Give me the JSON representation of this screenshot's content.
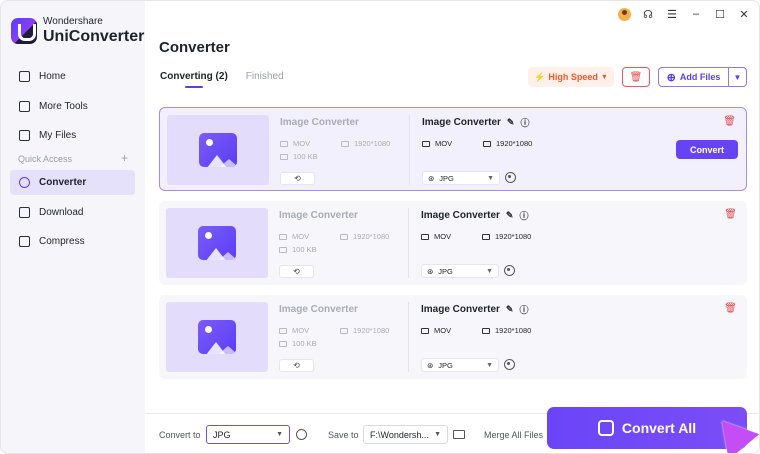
{
  "app": {
    "brand_small": "Wondershare",
    "brand_big": "UniConverter"
  },
  "sidebar": {
    "items": [
      {
        "label": "Home",
        "icon": "home-icon"
      },
      {
        "label": "More Tools",
        "icon": "toolbox-icon"
      },
      {
        "label": "My Files",
        "icon": "file-icon"
      }
    ],
    "quick_access_label": "Quick Access",
    "quick_items": [
      {
        "label": "Converter",
        "icon": "converter-icon",
        "active": true
      },
      {
        "label": "Download",
        "icon": "download-icon"
      },
      {
        "label": "Compress",
        "icon": "compress-icon"
      }
    ]
  },
  "header": {
    "title": "Converter",
    "tabs": [
      {
        "label": "Converting (2)",
        "active": true
      },
      {
        "label": "Finished"
      }
    ],
    "high_speed": "High Speed",
    "add_files": "Add Files"
  },
  "cards": [
    {
      "src_name": "Image Converter",
      "src_format": "MOV",
      "src_res": "1920*1080",
      "src_size": "100 KB",
      "dst_name": "Image Converter",
      "dst_format": "MOV",
      "dst_res": "1920*1080",
      "output_format": "JPG",
      "convert_label": "Convert",
      "selected": true
    },
    {
      "src_name": "Image Converter",
      "src_format": "MOV",
      "src_res": "1920*1080",
      "src_size": "100 KB",
      "dst_name": "Image Converter",
      "dst_format": "MOV",
      "dst_res": "1920*1080",
      "output_format": "JPG"
    },
    {
      "src_name": "Image Converter",
      "src_format": "MOV",
      "src_res": "1920*1080",
      "src_size": "100 KB",
      "dst_name": "Image Converter",
      "dst_format": "MOV",
      "dst_res": "1920*1080",
      "output_format": "JPG"
    }
  ],
  "bottom": {
    "convert_to_label": "Convert to",
    "convert_to_value": "JPG",
    "save_to_label": "Save to",
    "save_to_value": "F:\\Wondersh...",
    "merge_label": "Merge All Files",
    "convert_all": "Convert All"
  },
  "colors": {
    "accent": "#5b3df5",
    "danger": "#e5484d",
    "speed": "#f3572c"
  }
}
